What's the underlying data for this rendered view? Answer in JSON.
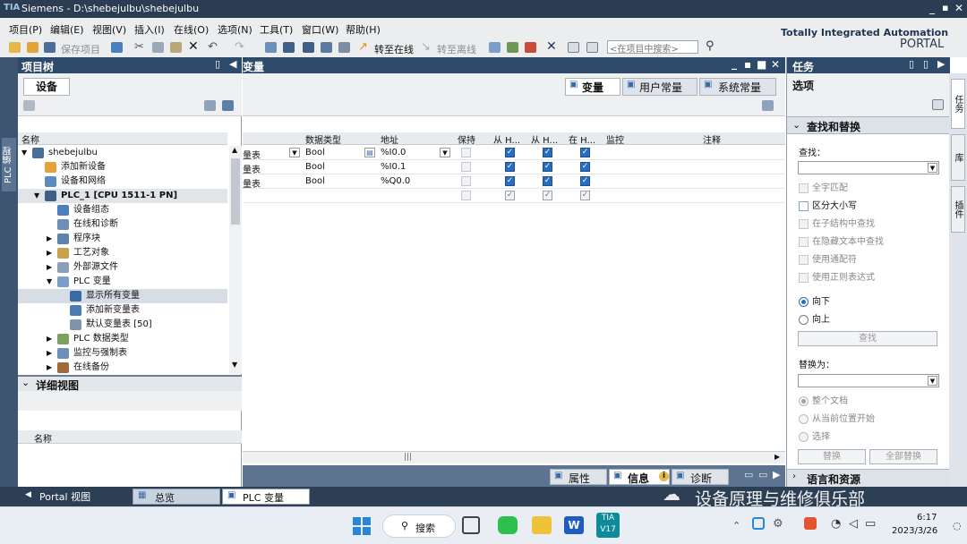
{
  "window": {
    "title": "Siemens  -  D:\\shebejulbu\\shebejulbu",
    "logo": "TIA"
  },
  "menu": [
    "项目(P)",
    "编辑(E)",
    "视图(V)",
    "插入(I)",
    "在线(O)",
    "选项(N)",
    "工具(T)",
    "窗口(W)",
    "帮助(H)"
  ],
  "toolbar": {
    "save": "保存项目",
    "go_online": "转至在线",
    "go_offline": "转至离线",
    "search_placeholder": "<在项目中搜索>"
  },
  "brand": {
    "line1": "Totally Integrated Automation",
    "line2": "PORTAL"
  },
  "project_tree": {
    "title": "项目树",
    "tab": "设备",
    "column": "名称",
    "side_label": "PLC 编程",
    "items": [
      {
        "label": "shebejulbu",
        "level": 0,
        "arrow": "▼",
        "selected": false
      },
      {
        "label": "添加新设备",
        "level": 1,
        "arrow": "",
        "selected": false
      },
      {
        "label": "设备和网络",
        "level": 1,
        "arrow": "",
        "selected": false
      },
      {
        "label": "PLC_1 [CPU 1511-1 PN]",
        "level": 1,
        "arrow": "▼",
        "selected": true,
        "bold": true
      },
      {
        "label": "设备组态",
        "level": 2,
        "arrow": "",
        "selected": false
      },
      {
        "label": "在线和诊断",
        "level": 2,
        "arrow": "",
        "selected": false
      },
      {
        "label": "程序块",
        "level": 2,
        "arrow": "▶",
        "selected": false
      },
      {
        "label": "工艺对象",
        "level": 2,
        "arrow": "▶",
        "selected": false
      },
      {
        "label": "外部源文件",
        "level": 2,
        "arrow": "▶",
        "selected": false
      },
      {
        "label": "PLC 变量",
        "level": 2,
        "arrow": "▼",
        "selected": false
      },
      {
        "label": "显示所有变量",
        "level": 3,
        "arrow": "",
        "selected": true
      },
      {
        "label": "添加新变量表",
        "level": 3,
        "arrow": "",
        "selected": false
      },
      {
        "label": "默认变量表 [50]",
        "level": 3,
        "arrow": "",
        "selected": false
      },
      {
        "label": "PLC 数据类型",
        "level": 2,
        "arrow": "▶",
        "selected": false
      },
      {
        "label": "监控与强制表",
        "level": 2,
        "arrow": "▶",
        "selected": false
      },
      {
        "label": "在线备份",
        "level": 2,
        "arrow": "▶",
        "selected": false
      }
    ]
  },
  "details": {
    "title": "详细视图",
    "column": "名称"
  },
  "editor": {
    "title": "变量",
    "tabs": [
      "变量",
      "用户常量",
      "系统常量"
    ],
    "columns": [
      "数据类型",
      "地址",
      "保持",
      "从 H...",
      "从 H...",
      "在 H...",
      "监控",
      "注释"
    ],
    "rows": [
      {
        "table": "量表",
        "type": "Bool",
        "address": "%I0.0",
        "retain": false,
        "c1": true,
        "c2": true,
        "c3": true,
        "active": true
      },
      {
        "table": "量表",
        "type": "Bool",
        "address": "%I0.1",
        "retain": false,
        "c1": true,
        "c2": true,
        "c3": true,
        "active": false
      },
      {
        "table": "量表",
        "type": "Bool",
        "address": "%Q0.0",
        "retain": false,
        "c1": true,
        "c2": true,
        "c3": true,
        "active": false
      },
      {
        "table": "",
        "type": "",
        "address": "",
        "retain": false,
        "c1": true,
        "c2": true,
        "c3": true,
        "active": false
      }
    ]
  },
  "inspector": {
    "properties": "属性",
    "info": "信息",
    "diagnostics": "诊断"
  },
  "tasks": {
    "title": "任务",
    "options": "选项",
    "find_replace": "查找和替换",
    "find_label": "查找：",
    "checks": [
      "全字匹配",
      "区分大小写",
      "在子结构中查找",
      "在隐藏文本中查找",
      "使用通配符",
      "使用正则表达式"
    ],
    "dir_down": "向下",
    "dir_up": "向上",
    "find_btn": "查找",
    "replace_label": "替换为：",
    "scope": [
      "整个文档",
      "从当前位置开始",
      "选择"
    ],
    "replace_btn": "替换",
    "replace_all_btn": "全部替换",
    "languages": "语言和资源",
    "side_tabs": [
      "任务",
      "库",
      "插件"
    ]
  },
  "portal_bar": {
    "portal": "Portal 视图",
    "overview": "总览",
    "plc_tags": "PLC 变量"
  },
  "watermark": "设备原理与维修俱乐部",
  "taskbar": {
    "search": "搜索",
    "time": "6:17",
    "date": "2023/3/26"
  }
}
